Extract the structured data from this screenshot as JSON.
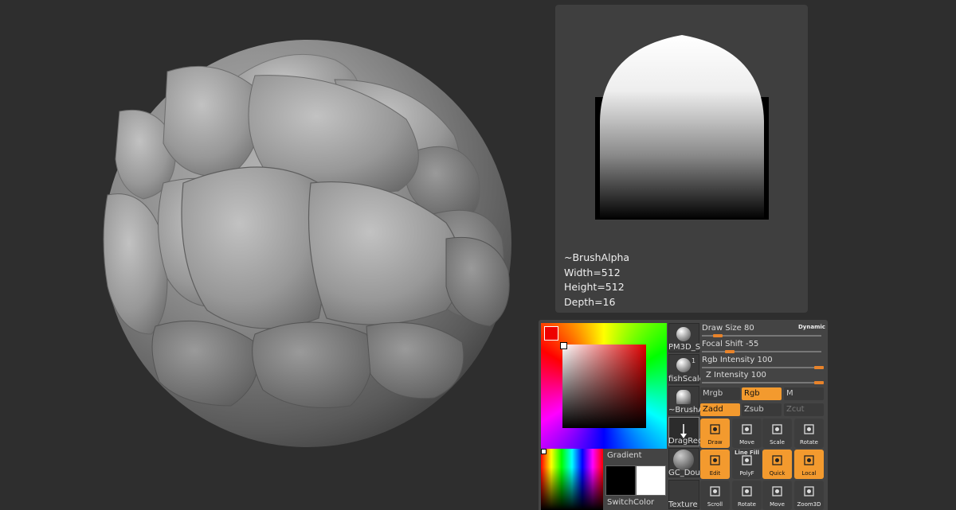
{
  "alpha_panel": {
    "name": "~BrushAlpha",
    "width": "Width=512",
    "height": "Height=512",
    "depth": "Depth=16"
  },
  "colors": {
    "main": "#ee0000",
    "secondary_black": "#000000",
    "secondary_white": "#ffffff",
    "accent_orange": "#f39a2e"
  },
  "color_panel": {
    "gradient_label": "Gradient",
    "switchcolor_label": "SwitchColor"
  },
  "thumbs": [
    {
      "label": "PM3D_S",
      "icon": "sphere-material-icon"
    },
    {
      "label": "fishScale",
      "badge": "1",
      "icon": "brush-icon"
    },
    {
      "label": "~BrushA",
      "icon": "alpha-icon"
    },
    {
      "label": "DragRec",
      "icon": "stroke-icon"
    },
    {
      "label": "GC_Dou",
      "icon": "material-icon"
    },
    {
      "label": "Texture",
      "icon": "texture-icon"
    }
  ],
  "sliders": [
    {
      "label": "Draw Size",
      "value": "80",
      "fraction": 0.12
    },
    {
      "label": "Focal Shift",
      "value": "-55",
      "fraction": 0.22
    },
    {
      "label": "Rgb Intensity",
      "value": "100",
      "fraction": 1.0
    },
    {
      "label": "Z Intensity",
      "value": "100",
      "fraction": 1.0
    }
  ],
  "dynamic_label": "Dynamic",
  "modes_row1": [
    {
      "label": "Mrgb",
      "active": false
    },
    {
      "label": "Rgb",
      "active": true
    },
    {
      "label": "M",
      "active": false
    }
  ],
  "modes_row2": [
    {
      "label": "Zadd",
      "active": true
    },
    {
      "label": "Zsub",
      "active": false
    },
    {
      "label": "Zcut",
      "active": false,
      "disabled": true
    }
  ],
  "tools_row1": [
    {
      "label": "Draw",
      "active": true,
      "icon": "draw-icon"
    },
    {
      "label": "Move",
      "active": false,
      "icon": "move-icon"
    },
    {
      "label": "Scale",
      "active": false,
      "icon": "scale-icon"
    },
    {
      "label": "Rotate",
      "active": false,
      "icon": "rotate-icon"
    }
  ],
  "tools_row2": [
    {
      "label": "Edit",
      "active": true,
      "icon": "edit-icon"
    },
    {
      "label": "PolyF",
      "top": "Line Fill",
      "active": false,
      "icon": "polyframe-icon"
    },
    {
      "label": "Quick",
      "active": true,
      "icon": "quick-icon"
    },
    {
      "label": "Local",
      "active": true,
      "icon": "local-icon"
    }
  ],
  "tools_row3": [
    {
      "label": "Scroll",
      "icon": "scroll-icon"
    },
    {
      "label": "Rotate",
      "icon": "rotate-view-icon"
    },
    {
      "label": "Move",
      "icon": "move-view-icon"
    },
    {
      "label": "Zoom3D",
      "icon": "zoom3d-icon"
    }
  ]
}
